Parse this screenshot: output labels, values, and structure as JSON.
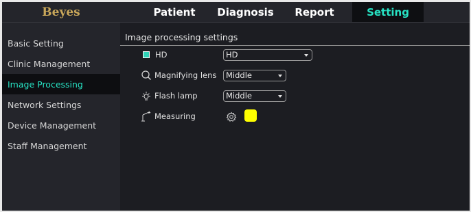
{
  "app": {
    "logo": "Beyes"
  },
  "tabs": [
    {
      "label": "Patient"
    },
    {
      "label": "Diagnosis"
    },
    {
      "label": "Report"
    },
    {
      "label": "Setting"
    }
  ],
  "active_tab": "Setting",
  "sidebar": {
    "items": [
      {
        "label": "Basic Setting"
      },
      {
        "label": "Clinic Management"
      },
      {
        "label": "Image Processing"
      },
      {
        "label": "Network Settings"
      },
      {
        "label": "Device Management"
      },
      {
        "label": "Staff Management"
      }
    ],
    "active_item": "Image Processing"
  },
  "main": {
    "title": "Image processing settings",
    "hd": {
      "label": "HD",
      "checked": true,
      "value": "HD"
    },
    "magnifying": {
      "label": "Magnifying lens",
      "value": "Middle",
      "icon": "search-icon"
    },
    "flash": {
      "label": "Flash lamp",
      "value": "Middle",
      "icon": "lamp-icon"
    },
    "measuring": {
      "label": "Measuring",
      "icon": "measure-icon",
      "color": "#ffff00"
    }
  },
  "colors": {
    "accent": "#27e3c4",
    "logo": "#c9a75a",
    "measure_swatch": "#ffff00"
  }
}
